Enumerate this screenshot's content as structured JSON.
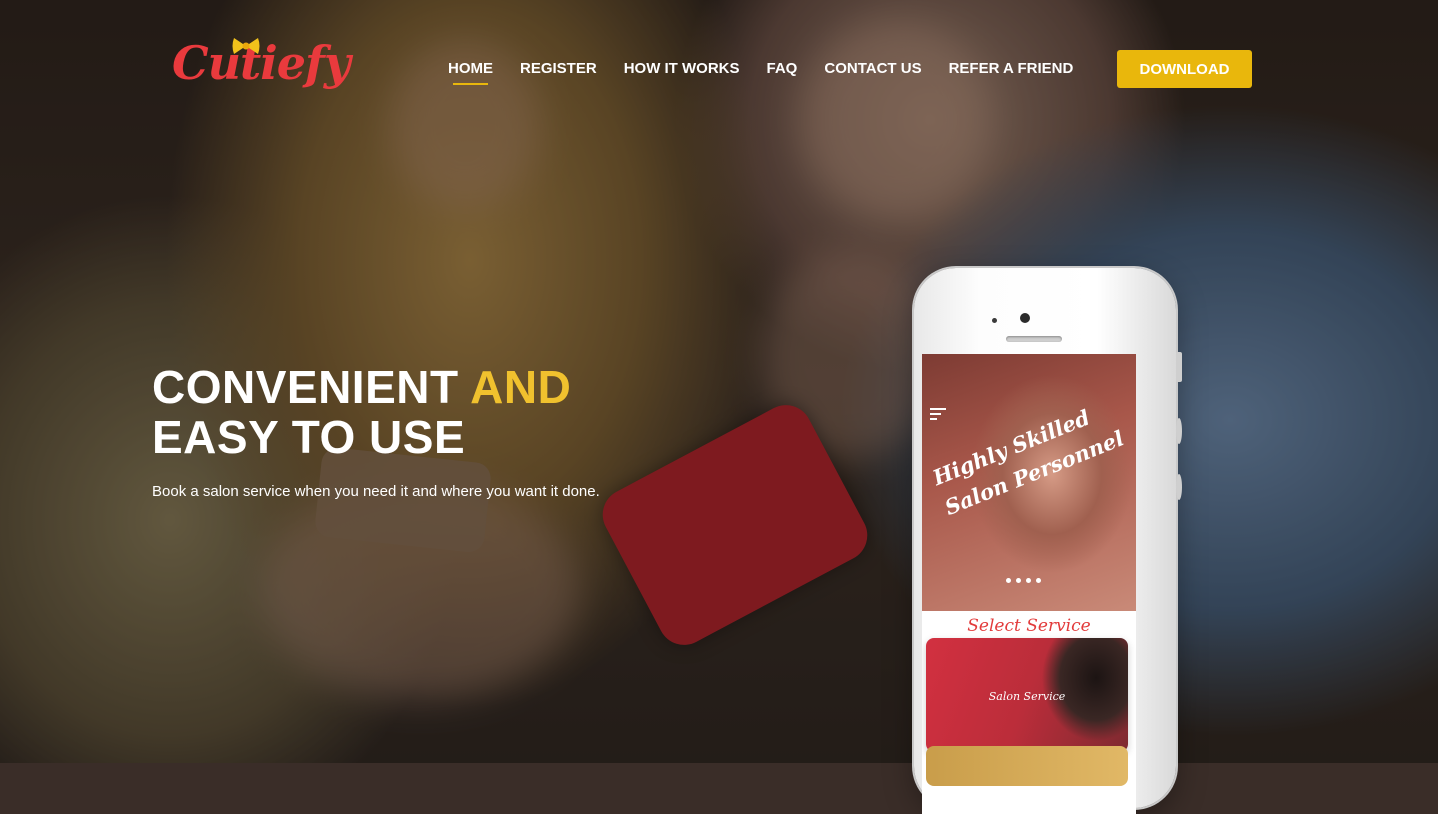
{
  "brand": {
    "logo_text": "Cutiefy"
  },
  "nav": {
    "items": [
      {
        "label": "HOME",
        "active": true
      },
      {
        "label": "REGISTER"
      },
      {
        "label": "HOW IT WORKS"
      },
      {
        "label": "FAQ"
      },
      {
        "label": "CONTACT US"
      },
      {
        "label": "REFER A FRIEND"
      }
    ],
    "download_label": "DOWNLOAD"
  },
  "hero": {
    "headline_part1": "CONVENIENT ",
    "headline_accent": "AND",
    "headline_line2": "EASY TO USE",
    "subtitle": "Book a salon service when you need it and where you want it done."
  },
  "phone": {
    "banner_line1": "Highly Skilled",
    "banner_line2": "Salon Personnel",
    "select_title": "Select Service",
    "service_label": "Salon Service"
  },
  "colors": {
    "accent_yellow": "#e9b70c",
    "brand_red": "#e93a3d"
  }
}
